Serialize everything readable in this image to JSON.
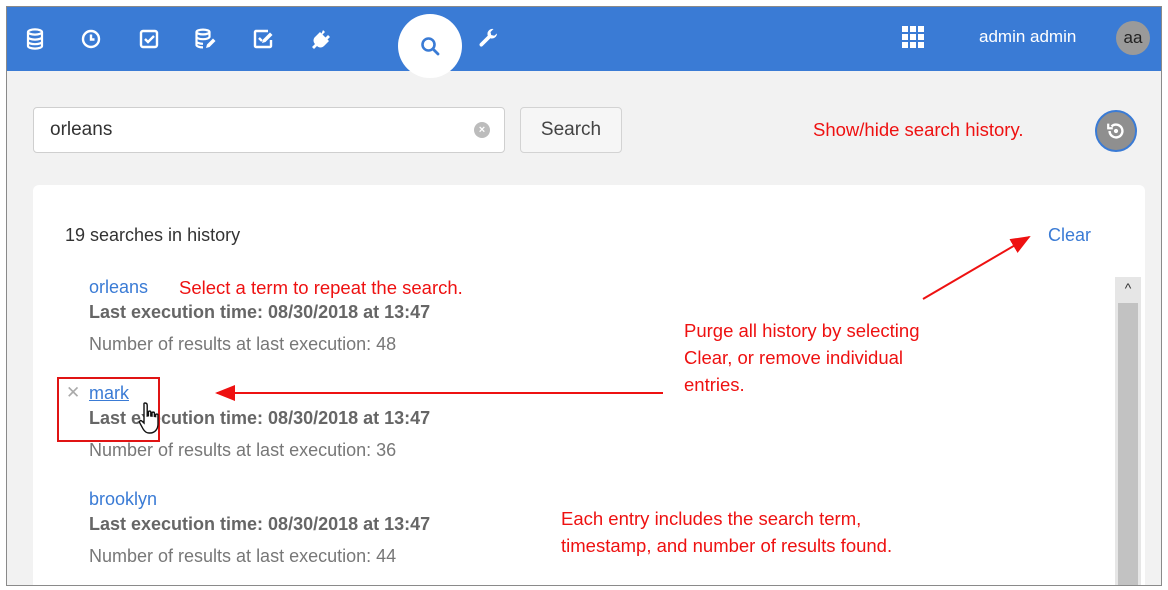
{
  "topbar": {
    "icons": [
      "database-icon",
      "history-clock-icon",
      "checkbox-icon",
      "database-edit-icon",
      "checkbox-edit-icon",
      "plug-icon",
      "search-icon",
      "wrench-icon"
    ],
    "apps_icon": "grid-apps-icon",
    "username": "admin admin",
    "avatar_initials": "aa",
    "color": "#3a7bd5"
  },
  "search": {
    "value": "orleans",
    "button_label": "Search"
  },
  "history": {
    "count_text": "19 searches in history",
    "clear_label": "Clear",
    "entries": [
      {
        "term": "orleans",
        "last_execution": "Last execution time: 08/30/2018 at 13:47",
        "results": "Number of results at last execution: 48"
      },
      {
        "term": "mark",
        "last_execution": "Last execution time: 08/30/2018 at 13:47",
        "results": "Number of results at last execution: 36"
      },
      {
        "term": "brooklyn",
        "last_execution": "Last execution time: 08/30/2018 at 13:47",
        "results": "Number of results at last execution: 44"
      }
    ]
  },
  "annotations": {
    "show_hide": "Show/hide search history.",
    "select_term": "Select a term to repeat the search.",
    "purge_line1": "Purge all history by selecting",
    "purge_line2": "Clear, or remove individual",
    "purge_line3": "entries.",
    "each_line1": "Each entry includes the search term,",
    "each_line2": "timestamp, and number of results found.",
    "color": "#ee1111"
  }
}
